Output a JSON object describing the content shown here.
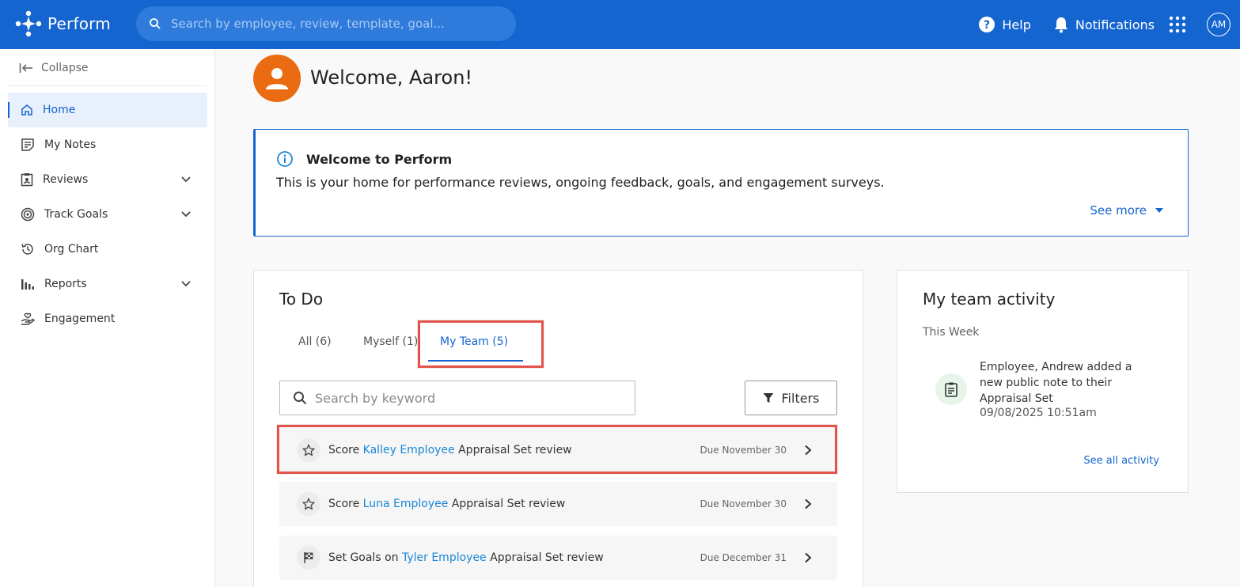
{
  "topbar": {
    "app_name": "Perform",
    "search_placeholder": "Search by employee, review, template, goal...",
    "help_label": "Help",
    "notifications_label": "Notifications",
    "avatar_initials": "AM",
    "brand_color": "#1565d0"
  },
  "sidebar": {
    "collapse_label": "Collapse",
    "items": [
      {
        "label": "Home",
        "icon": "home-icon",
        "active": true
      },
      {
        "label": "My Notes",
        "icon": "notes-icon"
      },
      {
        "label": "Reviews",
        "icon": "reviews-icon",
        "expandable": true
      },
      {
        "label": "Track Goals",
        "icon": "target-icon",
        "expandable": true
      },
      {
        "label": "Org Chart",
        "icon": "history-icon"
      },
      {
        "label": "Reports",
        "icon": "bar-chart-icon",
        "expandable": true
      },
      {
        "label": "Engagement",
        "icon": "engagement-icon"
      }
    ]
  },
  "main": {
    "welcome": "Welcome, Aaron!",
    "info": {
      "title": "Welcome to Perform",
      "body": "This is your home for performance reviews, ongoing feedback, goals, and engagement surveys.",
      "see_more": "See more"
    },
    "todo": {
      "title": "To Do",
      "tabs": [
        "All (6)",
        "Myself (1)",
        "My Team (5)"
      ],
      "active_tab": "My Team (5)",
      "search_placeholder": "Search by keyword",
      "filters_label": "Filters",
      "items": [
        {
          "prefix": "Score",
          "person": "Kalley Employee",
          "suffix": "Appraisal Set review",
          "due": "Due November 30",
          "icon": "star-icon"
        },
        {
          "prefix": "Score",
          "person": "Luna Employee",
          "suffix": "Appraisal Set review",
          "due": "Due November 30",
          "icon": "star-icon"
        },
        {
          "prefix": "Set Goals on",
          "person": "Tyler Employee",
          "suffix": "Appraisal Set review",
          "due": "Due December 31",
          "icon": "flag-icon"
        }
      ]
    },
    "activity": {
      "title": "My team activity",
      "period": "This Week",
      "entry_text": "Employee, Andrew added a new public note to their Appraisal Set",
      "entry_time": "09/08/2025 10:51am",
      "see_all": "See all activity"
    }
  },
  "colors": {
    "accent": "#1565d0",
    "link": "#1b87d6",
    "highlight": "#e4544b",
    "avatar": "#ea6b11"
  }
}
